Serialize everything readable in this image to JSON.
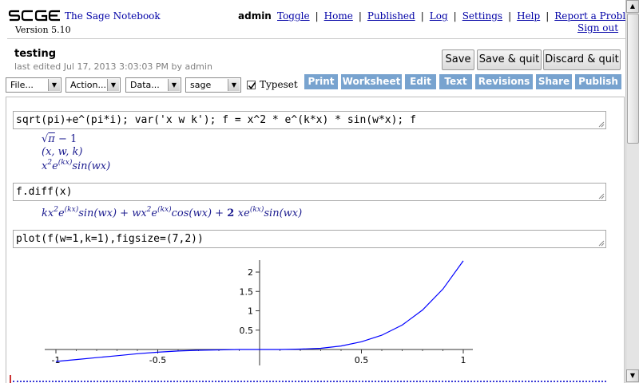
{
  "header": {
    "logo_text": "SAGE",
    "app_title": "The Sage Notebook",
    "version": "Version 5.10",
    "username": "admin",
    "links": [
      "Toggle",
      "Home",
      "Published",
      "Log",
      "Settings",
      "Help",
      "Report a Problem"
    ],
    "signout": "Sign out"
  },
  "worksheet": {
    "title": "testing",
    "last_edited": "last edited Jul 17, 2013 3:03:03 PM by admin",
    "buttons": {
      "save": "Save",
      "save_quit": "Save & quit",
      "discard_quit": "Discard & quit"
    }
  },
  "toolbar": {
    "file": "File...",
    "action": "Action...",
    "data": "Data...",
    "system": "sage",
    "typeset_label": "Typeset",
    "typeset_checked": true,
    "tabs": [
      "Print",
      "Worksheet",
      "Edit",
      "Text",
      "Revisions",
      "Share",
      "Publish"
    ],
    "tab_color": "#78a3cf"
  },
  "cells": [
    {
      "input": "sqrt(pi)+e^(pi*i); var('x w k'); f = x^2 * e^(k*x) * sin(w*x); f",
      "output": {
        "line1": {
          "radical": "√",
          "radicand": "π",
          "rest": " − 1"
        },
        "line2": "(x, w, k)",
        "line3": {
          "base": "x",
          "exp2": "2",
          "e": "e",
          "exp_kx": "(kx)",
          "tail": "sin(wx)"
        }
      }
    },
    {
      "input": "f.diff(x)",
      "output": {
        "t1_pre": "kx",
        "t1_exp": "2",
        "t1_e": "e",
        "t1_eexp": "(kx)",
        "t1_post": "sin(wx) + ",
        "t2_pre": "wx",
        "t2_exp": "2",
        "t2_e": "e",
        "t2_eexp": "(kx)",
        "t2_post": "cos(wx) + ",
        "t3_coef": "2 ",
        "t3_pre": "xe",
        "t3_eexp": "(kx)",
        "t3_post": "sin(wx)"
      }
    },
    {
      "input": "plot(f(w=1,k=1),figsize=(7,2))"
    }
  ],
  "chart_data": {
    "type": "line",
    "function": "x^2 * e^x * sin(x)",
    "xlim": [
      -1,
      1
    ],
    "ylim": [
      0,
      2.3
    ],
    "xticks": [
      -1,
      -0.5,
      0.5,
      1
    ],
    "yticks": [
      0.5,
      1,
      1.5,
      2
    ],
    "series": [
      {
        "color": "#0000ff",
        "x": [
          -1.0,
          -0.9,
          -0.8,
          -0.7,
          -0.6,
          -0.5,
          -0.4,
          -0.3,
          -0.2,
          -0.1,
          0.0,
          0.1,
          0.2,
          0.3,
          0.4,
          0.5,
          0.6,
          0.7,
          0.8,
          0.9,
          1.0
        ],
        "y": [
          -0.31,
          -0.26,
          -0.21,
          -0.16,
          -0.11,
          -0.07,
          -0.04,
          -0.02,
          -0.01,
          0.0,
          0.0,
          0.001,
          0.01,
          0.03,
          0.09,
          0.2,
          0.37,
          0.63,
          1.02,
          1.56,
          2.29
        ]
      }
    ]
  }
}
